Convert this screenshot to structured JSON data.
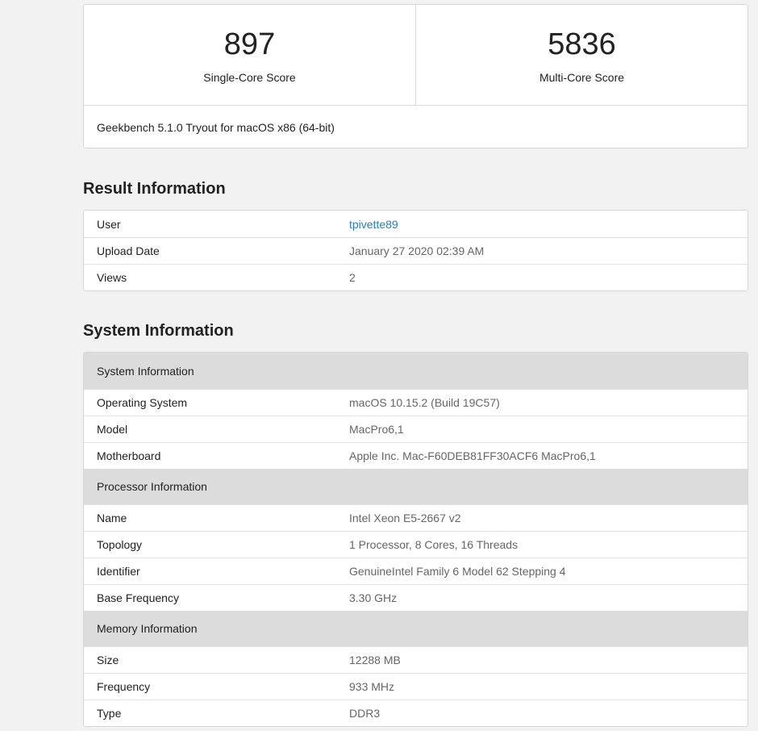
{
  "scores": {
    "single_core": {
      "value": "897",
      "label": "Single-Core Score"
    },
    "multi_core": {
      "value": "5836",
      "label": "Multi-Core Score"
    },
    "version": "Geekbench 5.1.0 Tryout for macOS x86 (64-bit)"
  },
  "result_information": {
    "title": "Result Information",
    "rows": [
      {
        "key": "User",
        "value": "tpivette89"
      },
      {
        "key": "Upload Date",
        "value": "January 27 2020 02:39 AM"
      },
      {
        "key": "Views",
        "value": "2"
      }
    ]
  },
  "system_information": {
    "title": "System Information",
    "groups": [
      {
        "heading": "System Information",
        "rows": [
          {
            "key": "Operating System",
            "value": "macOS 10.15.2 (Build 19C57)"
          },
          {
            "key": "Model",
            "value": "MacPro6,1"
          },
          {
            "key": "Motherboard",
            "value": "Apple Inc. Mac-F60DEB81FF30ACF6 MacPro6,1"
          }
        ]
      },
      {
        "heading": "Processor Information",
        "rows": [
          {
            "key": "Name",
            "value": "Intel Xeon E5-2667 v2"
          },
          {
            "key": "Topology",
            "value": "1 Processor, 8 Cores, 16 Threads"
          },
          {
            "key": "Identifier",
            "value": "GenuineIntel Family 6 Model 62 Stepping 4"
          },
          {
            "key": "Base Frequency",
            "value": "3.30 GHz"
          }
        ]
      },
      {
        "heading": "Memory Information",
        "rows": [
          {
            "key": "Size",
            "value": "12288 MB"
          },
          {
            "key": "Frequency",
            "value": "933 MHz"
          },
          {
            "key": "Type",
            "value": "DDR3"
          }
        ]
      }
    ]
  },
  "colors": {
    "link": "#2a7fb8",
    "group_header_bg": "#dcdcdc",
    "page_bg": "#f2f2f2"
  }
}
